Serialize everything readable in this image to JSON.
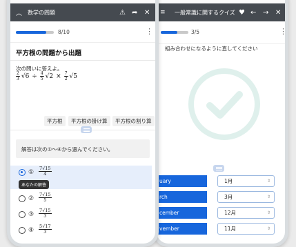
{
  "status": {
    "signal_icon": "signal-icon",
    "wifi_icon": "wifi-icon",
    "battery_icon": "battery-icon"
  },
  "right_phone": {
    "header": {
      "title": "一般常識に関するクイズ"
    },
    "progress": {
      "label": "3/5",
      "fraction": 0.6
    },
    "instruction": "組み合わせになるように直してください",
    "result_icon": "check-circle-icon",
    "matches": [
      {
        "left": "uary",
        "right": "1月"
      },
      {
        "left": "rch",
        "right": "3月"
      },
      {
        "left": "cember",
        "right": "12月"
      },
      {
        "left": "vember",
        "right": "11月"
      }
    ]
  },
  "left_phone": {
    "header": {
      "title": "数学の問題"
    },
    "progress": {
      "label": "8/10",
      "fraction": 0.8
    },
    "question_title": "平方根の問題から出題",
    "question_prompt": "次の問いに答えよ。",
    "expression": {
      "t1_num": "2",
      "t1_den": "3",
      "t1_root": "√6",
      "op1": "÷",
      "t2_num": "4",
      "t2_den": "5",
      "t2_root": "√2",
      "op2": "×",
      "t3_num": "7",
      "t3_den": "2",
      "t3_root": "√5"
    },
    "tags": [
      "平方根",
      "平方根の掛け算",
      "平方根の割り算"
    ],
    "answer_instruction": "解答は次の①～④から選んでください。",
    "your_answer_label": "あなたの解答",
    "options": [
      {
        "num": "①",
        "numerator": "7√15",
        "denominator": "4",
        "selected": true
      },
      {
        "num": "②",
        "numerator": "7√15",
        "denominator": "5",
        "selected": false
      },
      {
        "num": "③",
        "numerator": "7√15",
        "denominator": "3",
        "selected": false
      },
      {
        "num": "④",
        "numerator": "5√17",
        "denominator": "3",
        "selected": false
      }
    ]
  }
}
